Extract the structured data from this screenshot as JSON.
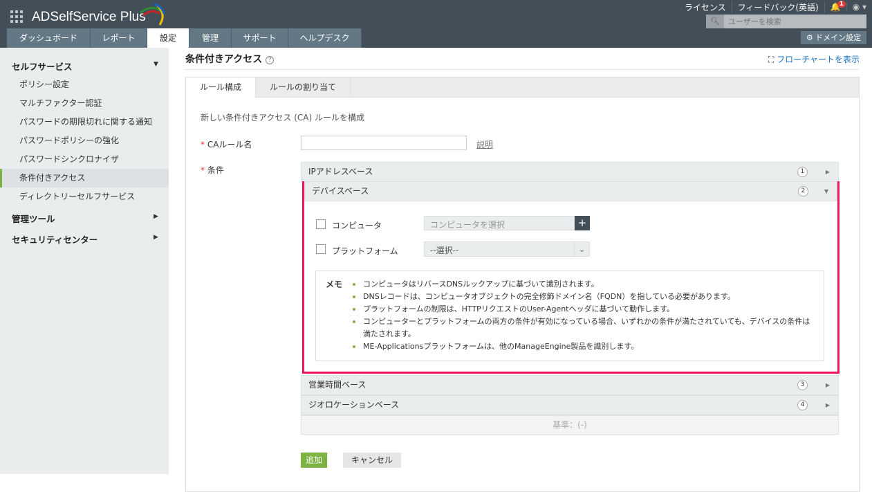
{
  "app": {
    "title": "ADSelfService Plus"
  },
  "nav_tabs": [
    "ダッシュボード",
    "レポート",
    "設定",
    "管理",
    "サポート",
    "ヘルプデスク"
  ],
  "top_links": {
    "license": "ライセンス",
    "feedback": "フィードバック(英語)",
    "notification_count": "1"
  },
  "search": {
    "placeholder": "ユーザーを検索"
  },
  "domain_settings": "ドメイン設定",
  "sidebar": {
    "self_service": "セルフサービス",
    "items": [
      "ポリシー設定",
      "マルチファクター認証",
      "パスワードの期限切れに関する通知",
      "パスワードポリシーの強化",
      "パスワードシンクロナイザ",
      "条件付きアクセス",
      "ディレクトリーセルフサービス"
    ],
    "admin_tools": "管理ツール",
    "security_center": "セキュリティセンター"
  },
  "page": {
    "title": "条件付きアクセス",
    "flowchart": "フローチャートを表示",
    "tabs": [
      "ルール構成",
      "ルールの割り当て"
    ],
    "subtitle": "新しい条件付きアクセス (CA) ルールを構成",
    "ca_rule_label": "CAルール名",
    "ca_rule_value": "",
    "explain_link": "説明",
    "condition_label": "条件",
    "accordion": [
      {
        "label": "IPアドレスベース",
        "num": "1"
      },
      {
        "label": "デバイスベース",
        "num": "2"
      },
      {
        "label": "営業時間ベース",
        "num": "3"
      },
      {
        "label": "ジオロケーションベース",
        "num": "4"
      }
    ],
    "computer_label": "コンピュータ",
    "computer_placeholder": "コンピュータを選択",
    "platform_label": "プラットフォーム",
    "platform_value": "--選択--",
    "memo_label": "メモ",
    "memo_items": [
      "コンピュータはリバースDNSルックアップに基づいて識別されます。",
      "DNSレコードは、コンピュータオブジェクトの完全修飾ドメイン名（FQDN）を指している必要があります。",
      "プラットフォームの制限は、HTTPリクエストのUser-Agentヘッダに基づいて動作します。",
      "コンピューターとプラットフォームの両方の条件が有効になっている場合、いずれかの条件が満たされていても、デバイスの条件は満たされます。",
      "ME-Applicationsプラットフォームは、他のManageEngine製品を識別します。"
    ],
    "criteria": "基準：(-)",
    "add": "追加",
    "cancel": "キャンセル"
  }
}
